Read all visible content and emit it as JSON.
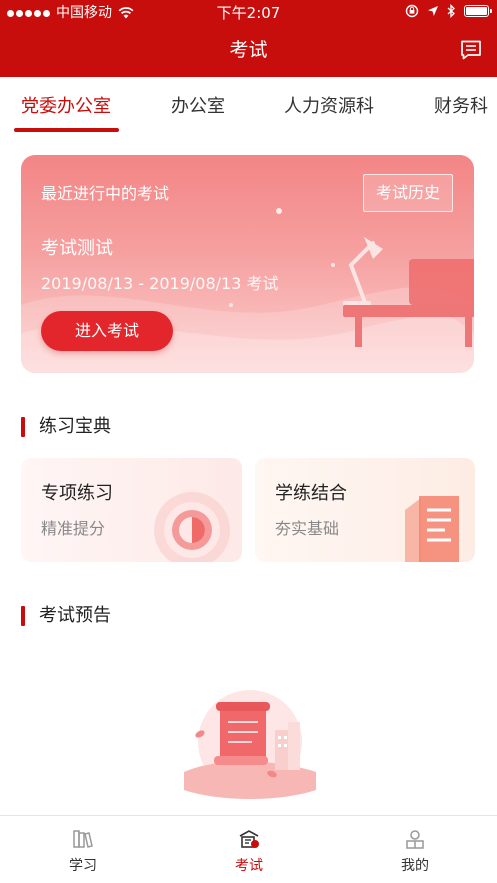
{
  "status_bar": {
    "carrier": "中国移动",
    "time": "下午2:07"
  },
  "nav": {
    "title": "考试",
    "message_icon": "message-icon"
  },
  "tabs": [
    {
      "label": "党委办公室",
      "active": true
    },
    {
      "label": "办公室",
      "active": false
    },
    {
      "label": "人力资源科",
      "active": false
    },
    {
      "label": "财务科",
      "active": false
    }
  ],
  "exam_card": {
    "recent_label": "最近进行中的考试",
    "history_label": "考试历史",
    "exam_title": "考试测试",
    "exam_date": "2019/08/13 - 2019/08/13 考试",
    "enter_label": "进入考试"
  },
  "practice": {
    "section_title": "练习宝典",
    "cards": [
      {
        "title": "专项练习",
        "subtitle": "精准提分",
        "icon": "target-icon"
      },
      {
        "title": "学练结合",
        "subtitle": "夯实基础",
        "icon": "document-icon"
      }
    ]
  },
  "preview": {
    "section_title": "考试预告",
    "illustration": "empty-scroll-illustration"
  },
  "bottom_nav": [
    {
      "label": "学习",
      "icon": "books-icon",
      "active": false
    },
    {
      "label": "考试",
      "icon": "exam-icon",
      "active": true
    },
    {
      "label": "我的",
      "icon": "user-icon",
      "active": false
    }
  ],
  "colors": {
    "brand": "#c80d0d",
    "button": "#e3262b"
  }
}
